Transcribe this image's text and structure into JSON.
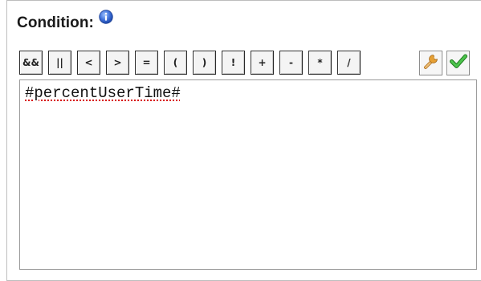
{
  "condition": {
    "label": "Condition:",
    "info_icon": "info-icon"
  },
  "toolbar": {
    "operators": [
      "&&",
      "||",
      "<",
      ">",
      "=",
      "(",
      ")",
      "!",
      "+",
      "-",
      "*",
      "/"
    ],
    "tools": [
      {
        "icon": "wrench-icon"
      },
      {
        "icon": "checkmark-icon"
      }
    ]
  },
  "editor": {
    "value": "#percentUserTime#"
  },
  "colors": {
    "info_blue": "#3d6fd8",
    "check_green": "#2fa02f",
    "wrench_orange": "#e6a034",
    "spellcheck_underline": "#d80000"
  }
}
